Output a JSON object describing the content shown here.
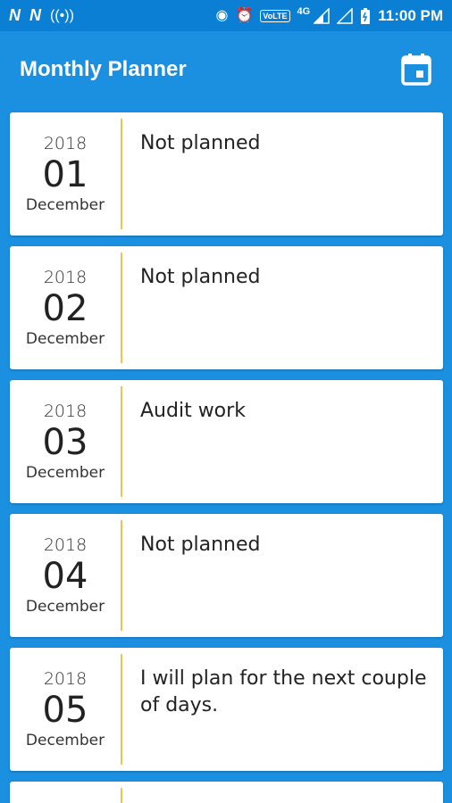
{
  "status_bar": {
    "left_icons": [
      "n-notification-icon",
      "n-notification-icon",
      "hotspot-icon"
    ],
    "network": "4G",
    "volte": "VoLTE",
    "time": "11:00 PM"
  },
  "app_bar": {
    "title": "Monthly Planner",
    "calendar_icon": "calendar-icon"
  },
  "entries": [
    {
      "year": "2018",
      "day": "01",
      "month": "December",
      "note": "Not planned"
    },
    {
      "year": "2018",
      "day": "02",
      "month": "December",
      "note": "Not planned"
    },
    {
      "year": "2018",
      "day": "03",
      "month": "December",
      "note": "Audit work"
    },
    {
      "year": "2018",
      "day": "04",
      "month": "December",
      "note": "Not planned"
    },
    {
      "year": "2018",
      "day": "05",
      "month": "December",
      "note": "I will plan for the next couple of days."
    }
  ],
  "colors": {
    "app_bar": "#1b8fe0",
    "status_bar": "#0b7fd4",
    "divider": "#f2c14e",
    "card": "#ffffff"
  }
}
